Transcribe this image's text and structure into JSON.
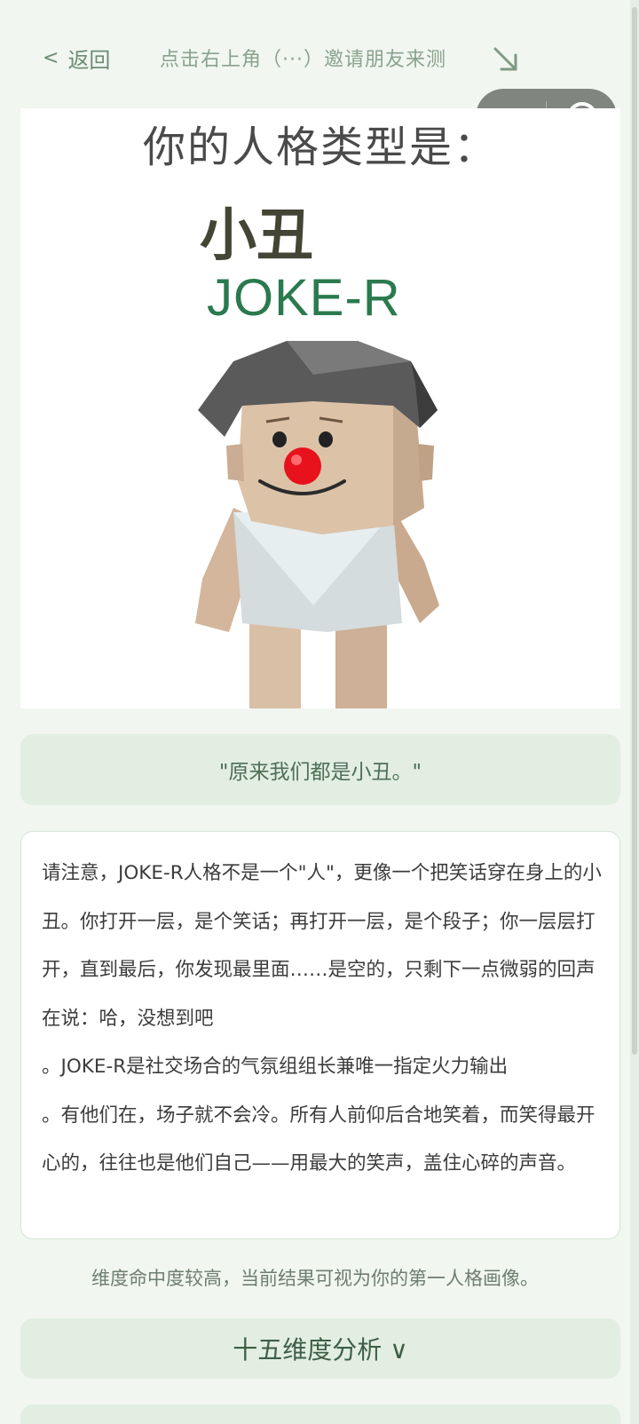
{
  "topbar": {
    "back_label": "返回",
    "back_chevron": "<",
    "invite_text": "点击右上角（···）邀请朋友来测"
  },
  "icons": {
    "back": "chevron-left-icon",
    "invite_arrow": "arrow-down-right-icon",
    "more": "more-dots-icon",
    "close": "close-miniprogram-icon"
  },
  "result": {
    "heading": "你的人格类型是：",
    "type_name": "小丑",
    "type_code": "JOKE-R"
  },
  "quote": "\"原来我们都是小丑。\"",
  "description": "请注意，JOKE-R人格不是一个\"人\"，更像一个把笑话穿在身上的小丑。你打开一层，是个笑话；再打开一层，是个段子；你一层层打开，直到最后，你发现最里面……是空的，只剩下一点微弱的回声在说：哈，没想到吧\n。JOKE-R是社交场合的气氛组组长兼唯一指定火力输出\n。有他们在，场子就不会冷。所有人前仰后合地笑着，而笑得最开心的，往往也是他们自己——用最大的笑声，盖住心碎的声音。",
  "note": "维度命中度较高，当前结果可视为你的第一人格画像。",
  "dimensions_button": "十五维度分析 ∨",
  "colors": {
    "background": "#f1f6f1",
    "card": "#e2eee2",
    "accent_green": "#2a7a4e",
    "clown_nose": "#e8121c"
  }
}
